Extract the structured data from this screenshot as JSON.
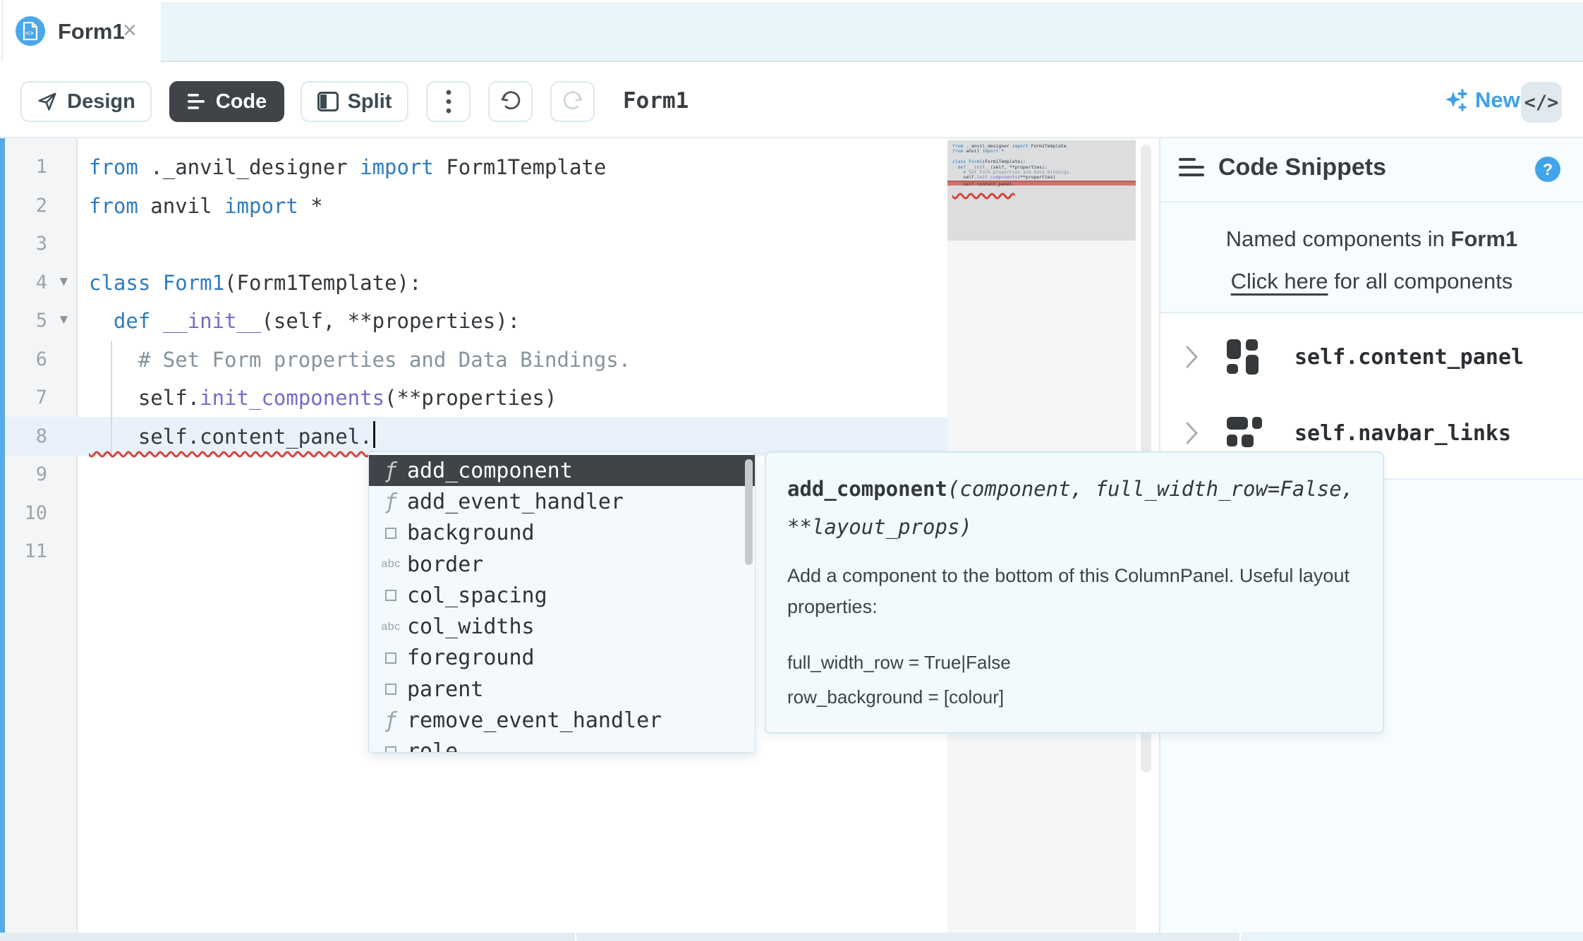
{
  "tab": {
    "title": "Form1",
    "close": "×"
  },
  "toolbar": {
    "design": "Design",
    "code": "Code",
    "split": "Split",
    "title": "Form1",
    "new_label": "New",
    "embed_label": "</>"
  },
  "editor": {
    "lines": [
      {
        "num": "1",
        "tokens": [
          {
            "c": "kw",
            "t": "from"
          },
          {
            "c": "pl",
            "t": " ._anvil_designer "
          },
          {
            "c": "kw",
            "t": "import"
          },
          {
            "c": "pl",
            "t": " Form1Template"
          }
        ]
      },
      {
        "num": "2",
        "tokens": [
          {
            "c": "kw",
            "t": "from"
          },
          {
            "c": "pl",
            "t": " anvil "
          },
          {
            "c": "kw",
            "t": "import"
          },
          {
            "c": "pl",
            "t": " *"
          }
        ]
      },
      {
        "num": "3",
        "tokens": []
      },
      {
        "num": "4",
        "fold": true,
        "tokens": [
          {
            "c": "kw",
            "t": "class"
          },
          {
            "c": "pl",
            "t": " "
          },
          {
            "c": "cl",
            "t": "Form1"
          },
          {
            "c": "pl",
            "t": "(Form1Template):"
          }
        ]
      },
      {
        "num": "5",
        "fold": true,
        "tokens": [
          {
            "c": "pl",
            "t": "  "
          },
          {
            "c": "kw",
            "t": "def"
          },
          {
            "c": "pl",
            "t": " "
          },
          {
            "c": "fn",
            "t": "__init__"
          },
          {
            "c": "pl",
            "t": "(self, **properties):"
          }
        ]
      },
      {
        "num": "6",
        "tokens": [
          {
            "c": "cm",
            "t": "    # Set Form properties and Data Bindings."
          }
        ]
      },
      {
        "num": "7",
        "tokens": [
          {
            "c": "pl",
            "t": "    self."
          },
          {
            "c": "fn",
            "t": "init_components"
          },
          {
            "c": "pl",
            "t": "(**properties)"
          }
        ]
      },
      {
        "num": "8",
        "cur": true,
        "err": true,
        "tokens": [
          {
            "c": "pl",
            "t": "    self.content_panel.",
            "wave": true
          }
        ]
      },
      {
        "num": "9",
        "tokens": []
      },
      {
        "num": "10",
        "tokens": []
      },
      {
        "num": "11",
        "tokens": []
      }
    ]
  },
  "autocomplete": {
    "items": [
      {
        "kind": "function",
        "label": "add_component",
        "selected": true
      },
      {
        "kind": "function",
        "label": "add_event_handler"
      },
      {
        "kind": "property",
        "label": "background"
      },
      {
        "kind": "string",
        "label": "border"
      },
      {
        "kind": "property",
        "label": "col_spacing"
      },
      {
        "kind": "string",
        "label": "col_widths"
      },
      {
        "kind": "property",
        "label": "foreground"
      },
      {
        "kind": "property",
        "label": "parent"
      },
      {
        "kind": "function",
        "label": "remove_event_handler"
      },
      {
        "kind": "property",
        "label": "role"
      }
    ]
  },
  "tooltip": {
    "signature_name": "add_component",
    "signature_args": "(component, full_width_row=False, **layout_props)",
    "description": "Add a component to the bottom of this ColumnPanel. Useful layout properties:",
    "props": [
      "full_width_row = True|False",
      "row_background = [colour]"
    ]
  },
  "snippets": {
    "title": "Code Snippets",
    "help": "?",
    "named_prefix": "Named components in ",
    "form_name": "Form1",
    "link_text": "Click here",
    "link_suffix": " for all components",
    "components": [
      {
        "name": "self.content_panel",
        "icon": "column-panel"
      },
      {
        "name": "self.navbar_links",
        "icon": "flow-panel"
      }
    ]
  },
  "colors": {
    "accent_blue": "#3fa0e8",
    "keyword": "#2e7cc0",
    "function": "#7b68c9",
    "comment": "#85939c",
    "error_red": "#d8433c",
    "selected_dark": "#404448",
    "tab_icon_blue": "#4ba7e9",
    "minimap_error": "#cf746c"
  }
}
